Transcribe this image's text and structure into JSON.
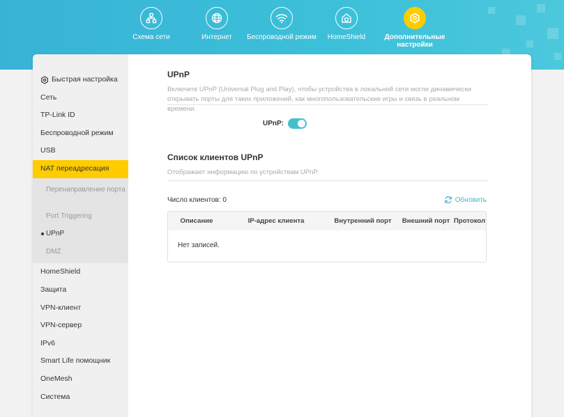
{
  "colors": {
    "header": "#3cbad7",
    "accent": "#ffcc00",
    "toggle": "#45c0ca",
    "link": "#45b8c8"
  },
  "top_nav": [
    {
      "label": "Схема сети",
      "icon": "network-map-icon"
    },
    {
      "label": "Интернет",
      "icon": "globe-icon"
    },
    {
      "label": "Беспроводной режим",
      "icon": "wifi-icon"
    },
    {
      "label": "HomeShield",
      "icon": "homeshield-icon"
    },
    {
      "label": "Дополнительные настройки",
      "icon": "advanced-gear-icon",
      "active": true
    }
  ],
  "sidebar": {
    "items": [
      {
        "label": "Быстрая настройка",
        "icon": "quick-setup-icon"
      },
      {
        "label": "Сеть"
      },
      {
        "label": "TP-Link ID"
      },
      {
        "label": "Беспроводной режим"
      },
      {
        "label": "USB"
      },
      {
        "label": "NAT переадресация",
        "active": true
      },
      {
        "label": "HomeShield"
      },
      {
        "label": "Защита"
      },
      {
        "label": "VPN-клиент"
      },
      {
        "label": "VPN-сервер"
      },
      {
        "label": "IPv6"
      },
      {
        "label": "Smart Life помощник"
      },
      {
        "label": "OneMesh"
      },
      {
        "label": "Система"
      }
    ],
    "nat_submenu": [
      {
        "label": "Перенаправление порта"
      },
      {
        "label": "Port Triggering"
      },
      {
        "label": "UPnP",
        "current": true
      },
      {
        "label": "DMZ"
      }
    ]
  },
  "upnp": {
    "title": "UPnP",
    "description": "Включите UPnP (Universal Plug and Play), чтобы устройства в локальной сети могли динамически открывать порты для таких приложений, как многопользовательские игры и связь в реальном времени.",
    "toggle_label": "UPnP:",
    "enabled": true
  },
  "clients": {
    "title": "Список клиентов UPnP",
    "description": "Отображает информацию по устройствам UPnP.",
    "count_label": "Число клиентов: 0",
    "refresh_label": "Обновить",
    "columns": [
      "Описание",
      "IP-адрес клиента",
      "Внутренний порт",
      "Внешний порт",
      "Протокол"
    ],
    "empty_text": "Нет записей."
  }
}
